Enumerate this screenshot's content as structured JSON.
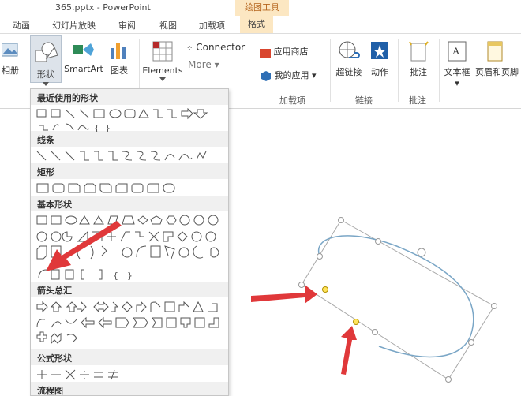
{
  "window": {
    "title": "365.pptx - PowerPoint",
    "context_group": "绘图工具"
  },
  "tabs": [
    "动画",
    "幻灯片放映",
    "审阅",
    "视图",
    "加载项",
    "格式"
  ],
  "ribbon": {
    "album_label": "相册",
    "shapes_label": "形状",
    "smartart_label": "SmartArt",
    "chart_label": "图表",
    "elements_label": "Elements",
    "connector_label": "Connector",
    "more_label": "More",
    "app_store_label": "应用商店",
    "my_apps_label": "我的应用",
    "addins_group_label": "加载项",
    "hyperlink_label": "超链接",
    "action_label": "动作",
    "links_group_label": "链接",
    "comment_label": "批注",
    "comments_group_label": "批注",
    "textbox_label": "文本框",
    "header_footer_label": "页眉和页脚"
  },
  "gallery": {
    "sections": [
      {
        "title": "最近使用的形状"
      },
      {
        "title": "线条"
      },
      {
        "title": "矩形"
      },
      {
        "title": "基本形状"
      },
      {
        "title": "箭头总汇"
      },
      {
        "title": "公式形状"
      },
      {
        "title": "流程图"
      }
    ]
  },
  "accent": {
    "context_tab_bg": "#fce7c2",
    "context_tab_text": "#b5651d",
    "annotation_arrow": "#e0383a",
    "shape_stroke": "#7aa6c6"
  }
}
